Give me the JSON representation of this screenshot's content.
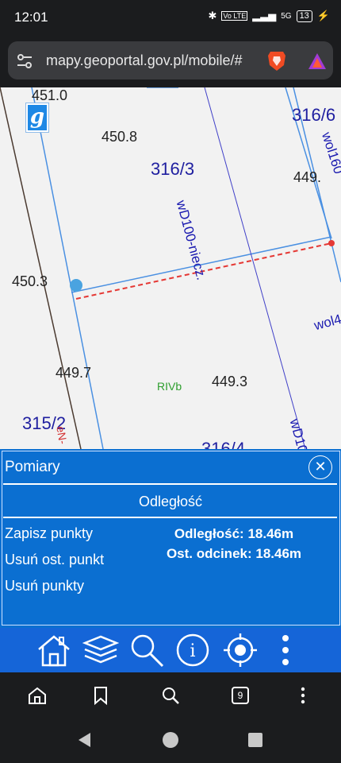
{
  "status": {
    "time": "12:01",
    "network": "5G",
    "battery": "13"
  },
  "browser": {
    "url": "mapy.geoportal.gov.pl/mobile/#",
    "tab_count": "9"
  },
  "map": {
    "elevations": [
      "451.0",
      "450.8",
      "449.",
      "450.3",
      "449.7",
      "449.3"
    ],
    "parcels": [
      "316/6",
      "316/3",
      "315/2",
      "316/4"
    ],
    "pipes": [
      "wD100-niecz.",
      "wol160",
      "wol4",
      "wD10"
    ],
    "soil_class": "RIVb",
    "edge_label": "eN-"
  },
  "panel": {
    "title": "Pomiary",
    "mode": "Odległość",
    "actions": [
      "Zapisz punkty",
      "Usuń ost. punkt",
      "Usuń punkty"
    ],
    "distance": "Odległość: 18.46m",
    "last_segment": "Ost. odcinek: 18.46m"
  },
  "colors": {
    "panel": "#0b6fd1",
    "toolbar": "#1565d8",
    "measure_line": "#e53935",
    "point": "#4aa3e0"
  }
}
